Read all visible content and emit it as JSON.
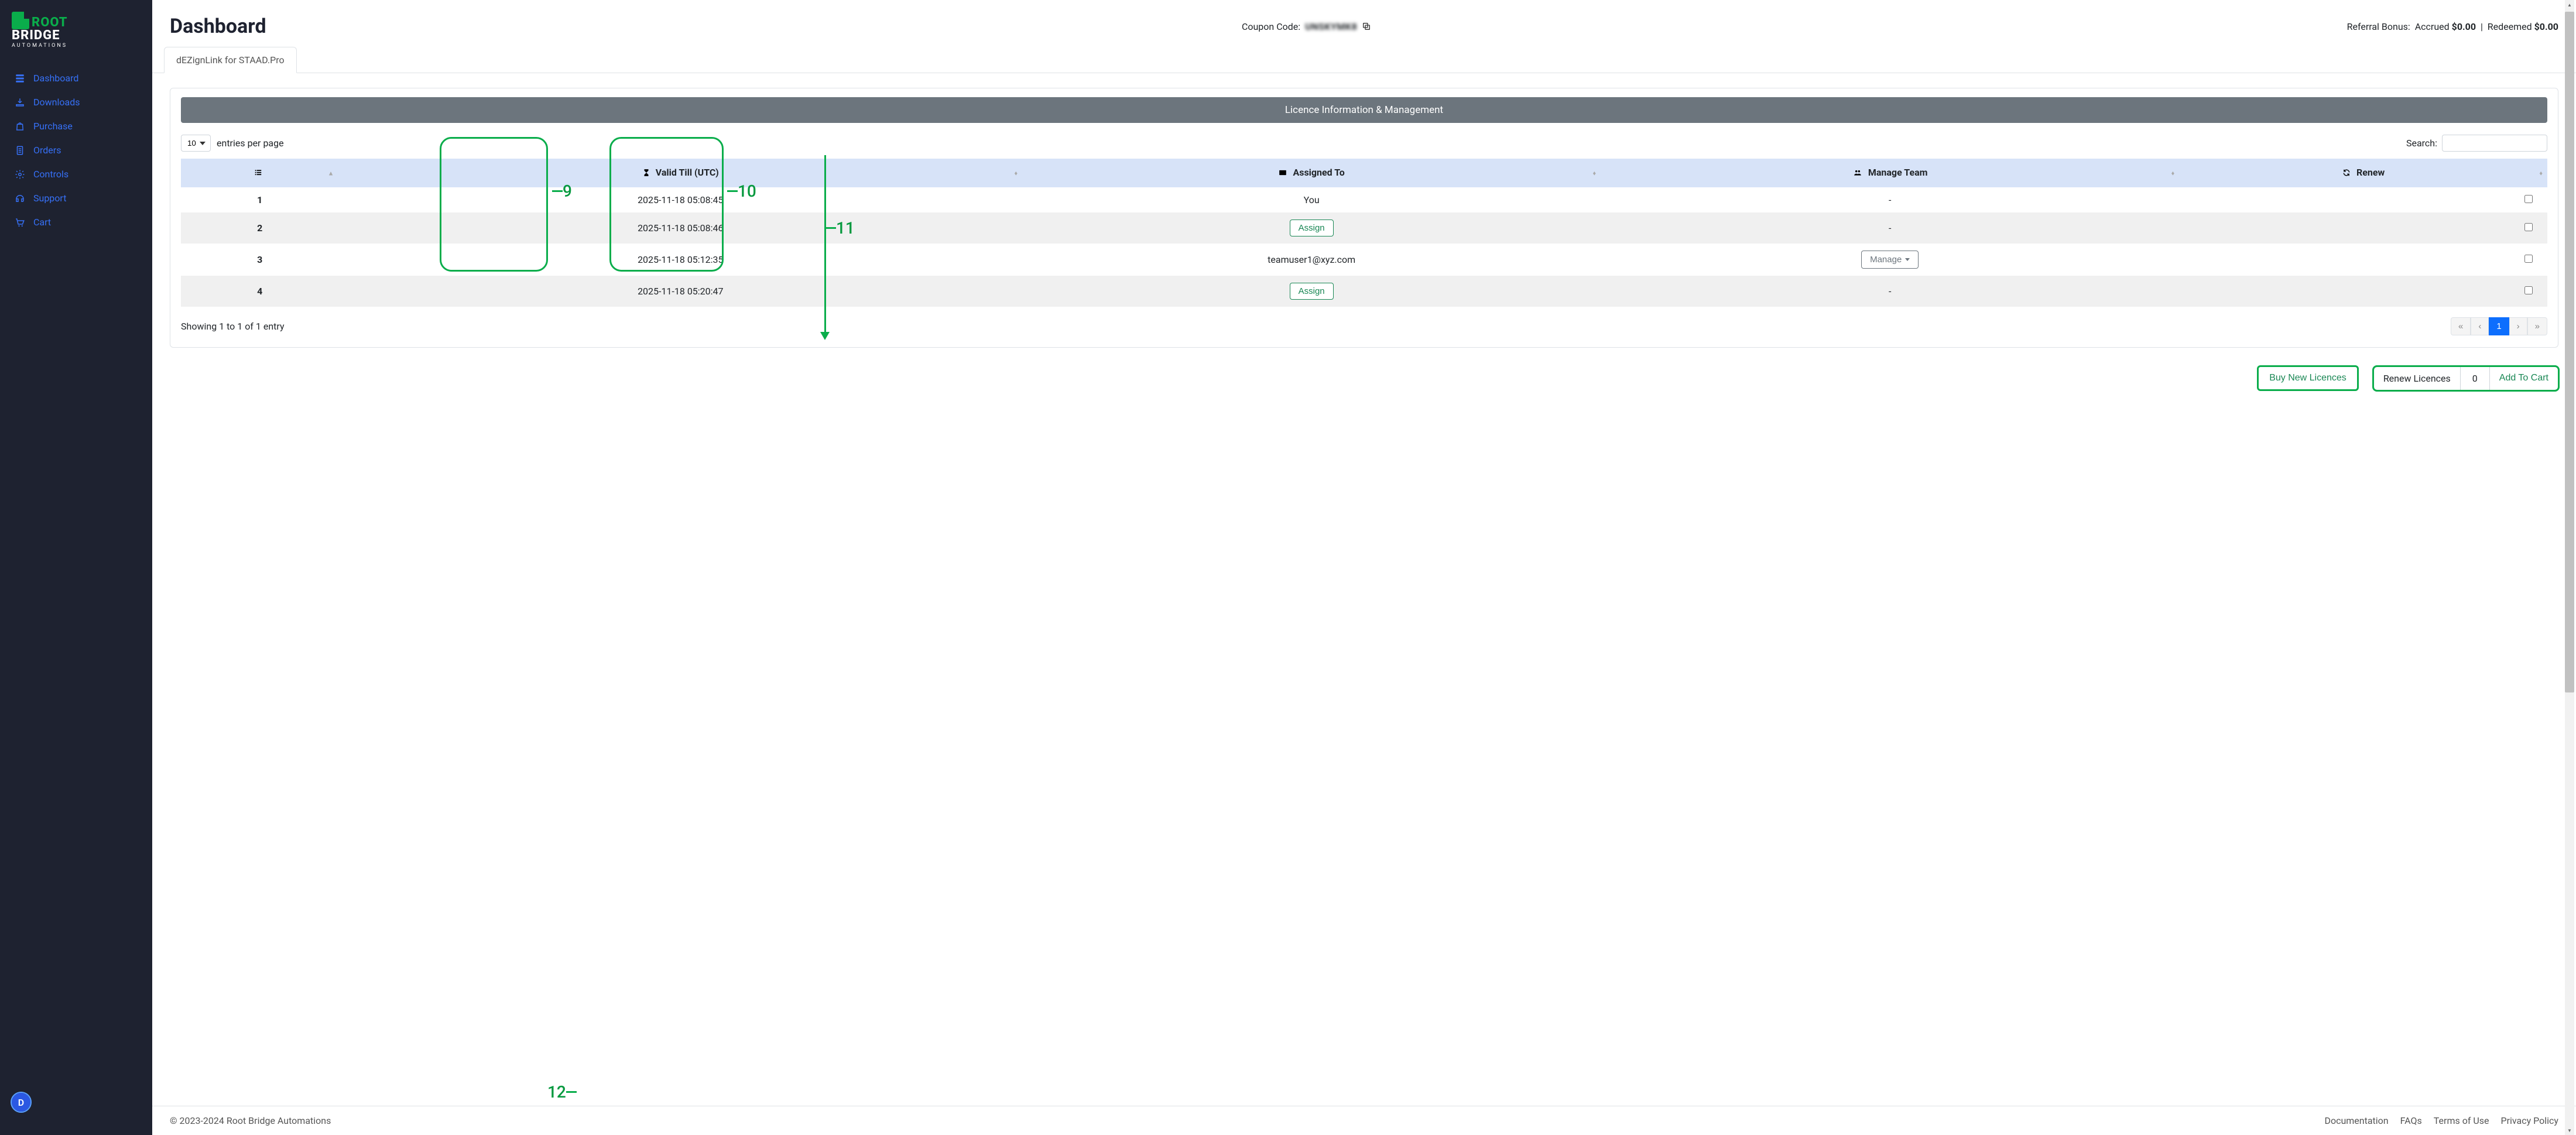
{
  "brand": {
    "root": "ROOT",
    "bridge": "BRIDGE",
    "auto": "AUTOMATIONS"
  },
  "nav": [
    {
      "label": "Dashboard",
      "icon": "dashboard-icon"
    },
    {
      "label": "Downloads",
      "icon": "download-icon"
    },
    {
      "label": "Purchase",
      "icon": "bag-icon"
    },
    {
      "label": "Orders",
      "icon": "clipboard-icon"
    },
    {
      "label": "Controls",
      "icon": "gear-icon"
    },
    {
      "label": "Support",
      "icon": "headset-icon"
    },
    {
      "label": "Cart",
      "icon": "cart-icon"
    }
  ],
  "avatar_letter": "D",
  "page_title": "Dashboard",
  "coupon": {
    "label": "Coupon Code:",
    "code": "UNSKYMK8"
  },
  "referral": {
    "label": "Referral Bonus:",
    "accrued_label": "Accrued",
    "accrued_value": "$0.00",
    "sep": "|",
    "redeemed_label": "Redeemed",
    "redeemed_value": "$0.00"
  },
  "tab_label": "dEZignLink for STAAD.Pro",
  "card_title": "Licence Information & Management",
  "entries": {
    "value": "10",
    "suffix": "entries per page"
  },
  "search_label": "Search:",
  "columns": {
    "idx": "",
    "valid": "Valid Till (UTC)",
    "assigned": "Assigned To",
    "team": "Manage Team",
    "renew": "Renew"
  },
  "rows": [
    {
      "n": "1",
      "valid": "2025-11-18 05:08:45",
      "assigned_text": "You",
      "assigned_btn": "",
      "team_btn": "",
      "team_text": "-"
    },
    {
      "n": "2",
      "valid": "2025-11-18 05:08:46",
      "assigned_text": "",
      "assigned_btn": "Assign",
      "team_btn": "",
      "team_text": "-"
    },
    {
      "n": "3",
      "valid": "2025-11-18 05:12:35",
      "assigned_text": "teamuser1@xyz.com",
      "assigned_btn": "",
      "team_btn": "Manage",
      "team_text": ""
    },
    {
      "n": "4",
      "valid": "2025-11-18 05:20:47",
      "assigned_text": "",
      "assigned_btn": "Assign",
      "team_btn": "",
      "team_text": "-"
    }
  ],
  "showing": "Showing 1 to 1 of 1 entry",
  "pagination": {
    "first": "«",
    "prev": "‹",
    "page": "1",
    "next": "›",
    "last": "»"
  },
  "buy_label": "Buy New Licences",
  "renew_group": {
    "label": "Renew Licences",
    "count": "0",
    "add": "Add To Cart"
  },
  "footer": {
    "copyright": "© 2023-2024 Root Bridge Automations",
    "links": [
      "Documentation",
      "FAQs",
      "Terms of Use",
      "Privacy Policy"
    ]
  },
  "annotations": {
    "a9": "9",
    "a10": "10",
    "a11": "11",
    "a12": "12"
  }
}
